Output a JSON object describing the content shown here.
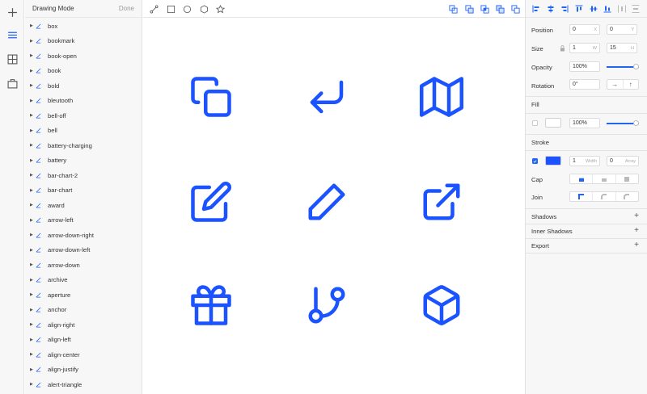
{
  "colors": {
    "accent": "#2166f3",
    "icon_blue": "#1a53ff",
    "stroke_swatch": "#1a53ff"
  },
  "rail": {
    "icons": [
      "plus-icon",
      "layers-list-icon",
      "grid-icon",
      "briefcase-icon"
    ]
  },
  "layers": {
    "title": "Drawing Mode",
    "done_label": "Done",
    "items": [
      "box",
      "bookmark",
      "book-open",
      "book",
      "bold",
      "bleutooth",
      "bell-off",
      "bell",
      "battery-charging",
      "battery",
      "bar-chart-2",
      "bar-chart",
      "award",
      "arrow-left",
      "arrow-down-right",
      "arrow-down-left",
      "arrow-down",
      "archive",
      "aperture",
      "anchor",
      "align-right",
      "align-left",
      "align-center",
      "align-justify",
      "alert-triangle"
    ]
  },
  "toolbar": {
    "left_tools": [
      "vector-tool-icon",
      "rectangle-tool-icon",
      "oval-tool-icon",
      "polygon-tool-icon",
      "star-tool-icon"
    ],
    "right_tools": [
      "union-icon",
      "subtract-icon",
      "intersect-icon",
      "difference-icon",
      "flatten-icon"
    ]
  },
  "canvas": {
    "icons": [
      "copy-icon",
      "corner-down-left-icon",
      "map-icon",
      "edit-icon",
      "edit-pencil-icon",
      "external-link-icon",
      "gift-icon",
      "git-branch-icon",
      "box-icon"
    ]
  },
  "inspector": {
    "position": {
      "label": "Position",
      "x": "0",
      "x_suffix": "X",
      "y": "0",
      "y_suffix": "Y"
    },
    "size": {
      "label": "Size",
      "w": "1",
      "w_suffix": "W",
      "h": "15",
      "h_suffix": "H"
    },
    "opacity": {
      "label": "Opacity",
      "value": "100%"
    },
    "rotation": {
      "label": "Rotation",
      "value": "0°"
    },
    "fill": {
      "label": "Fill",
      "opacity": "100%"
    },
    "stroke": {
      "label": "Stroke",
      "width": "1",
      "width_suffix": "Width",
      "array": "0",
      "array_suffix": "Array"
    },
    "cap": {
      "label": "Cap"
    },
    "join": {
      "label": "Join"
    },
    "shadows": "Shadows",
    "inner_shadows": "Inner Shadows",
    "export": "Export",
    "plus": "+",
    "rotate_glyphs": [
      "→",
      "↑"
    ]
  }
}
